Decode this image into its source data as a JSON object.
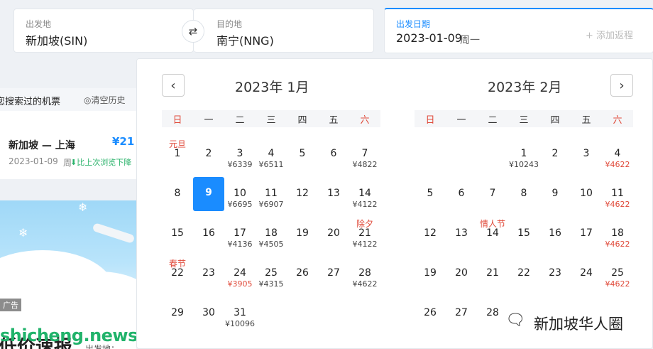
{
  "search": {
    "from_label": "出发地",
    "from_value": "新加坡(SIN)",
    "to_label": "目的地",
    "to_value": "南宁(NNG)",
    "date_label": "出发日期",
    "date_value": "2023-01-09",
    "date_weekday": "周一",
    "return_label": "+ 添加返程",
    "swap_icon": "⇄"
  },
  "history": {
    "title": "您搜索过的机票",
    "clear": "◎清空历史",
    "route": "新加坡 — 上海",
    "price": "¥21",
    "date": "2023-01-09",
    "weekday": "周",
    "compare": "⬇比上次浏览下降"
  },
  "banner": {
    "ad": "广告",
    "bottom_big": "低价速报",
    "bottom_from": "出发地："
  },
  "watermarks": {
    "left": "shicheng.news",
    "right": "新加坡华人圈",
    "right_icon": "🗨"
  },
  "calendar": {
    "prev_icon": "‹",
    "next_icon": "›",
    "weekdays": [
      "日",
      "一",
      "二",
      "三",
      "四",
      "五",
      "六"
    ],
    "months": [
      {
        "title": "2023年 1月",
        "offset": 0,
        "days": [
          {
            "d": "1",
            "f": "元旦",
            "p": ""
          },
          {
            "d": "2",
            "f": "",
            "p": ""
          },
          {
            "d": "3",
            "f": "",
            "p": "¥6339"
          },
          {
            "d": "4",
            "f": "",
            "p": "¥6511"
          },
          {
            "d": "5",
            "f": "",
            "p": ""
          },
          {
            "d": "6",
            "f": "",
            "p": ""
          },
          {
            "d": "7",
            "f": "",
            "p": "¥4822"
          },
          {
            "d": "8",
            "f": "",
            "p": ""
          },
          {
            "d": "9",
            "f": "",
            "p": "",
            "sel": true
          },
          {
            "d": "10",
            "f": "",
            "p": "¥6695"
          },
          {
            "d": "11",
            "f": "",
            "p": "¥6907"
          },
          {
            "d": "12",
            "f": "",
            "p": ""
          },
          {
            "d": "13",
            "f": "",
            "p": ""
          },
          {
            "d": "14",
            "f": "",
            "p": "¥4122"
          },
          {
            "d": "15",
            "f": "",
            "p": ""
          },
          {
            "d": "16",
            "f": "",
            "p": ""
          },
          {
            "d": "17",
            "f": "",
            "p": "¥4136"
          },
          {
            "d": "18",
            "f": "",
            "p": "¥4505"
          },
          {
            "d": "19",
            "f": "",
            "p": ""
          },
          {
            "d": "20",
            "f": "",
            "p": ""
          },
          {
            "d": "21",
            "f": "除夕",
            "p": "¥4122"
          },
          {
            "d": "22",
            "f": "春节",
            "p": ""
          },
          {
            "d": "23",
            "f": "",
            "p": ""
          },
          {
            "d": "24",
            "f": "",
            "p": "¥3905",
            "red": true
          },
          {
            "d": "25",
            "f": "",
            "p": "¥4315"
          },
          {
            "d": "26",
            "f": "",
            "p": ""
          },
          {
            "d": "27",
            "f": "",
            "p": ""
          },
          {
            "d": "28",
            "f": "",
            "p": "¥4622"
          },
          {
            "d": "29",
            "f": "",
            "p": ""
          },
          {
            "d": "30",
            "f": "",
            "p": ""
          },
          {
            "d": "31",
            "f": "",
            "p": "¥10096"
          }
        ]
      },
      {
        "title": "2023年 2月",
        "offset": 3,
        "days": [
          {
            "d": "1",
            "f": "",
            "p": "¥10243"
          },
          {
            "d": "2",
            "f": "",
            "p": ""
          },
          {
            "d": "3",
            "f": "",
            "p": ""
          },
          {
            "d": "4",
            "f": "",
            "p": "¥4622",
            "red": true
          },
          {
            "d": "5",
            "f": "",
            "p": ""
          },
          {
            "d": "6",
            "f": "",
            "p": ""
          },
          {
            "d": "7",
            "f": "",
            "p": ""
          },
          {
            "d": "8",
            "f": "",
            "p": ""
          },
          {
            "d": "9",
            "f": "",
            "p": ""
          },
          {
            "d": "10",
            "f": "",
            "p": ""
          },
          {
            "d": "11",
            "f": "",
            "p": "¥4622",
            "red": true
          },
          {
            "d": "12",
            "f": "",
            "p": ""
          },
          {
            "d": "13",
            "f": "",
            "p": ""
          },
          {
            "d": "14",
            "f": "情人节",
            "p": ""
          },
          {
            "d": "15",
            "f": "",
            "p": ""
          },
          {
            "d": "16",
            "f": "",
            "p": ""
          },
          {
            "d": "17",
            "f": "",
            "p": ""
          },
          {
            "d": "18",
            "f": "",
            "p": "¥4622",
            "red": true
          },
          {
            "d": "19",
            "f": "",
            "p": ""
          },
          {
            "d": "20",
            "f": "",
            "p": ""
          },
          {
            "d": "21",
            "f": "",
            "p": ""
          },
          {
            "d": "22",
            "f": "",
            "p": ""
          },
          {
            "d": "23",
            "f": "",
            "p": ""
          },
          {
            "d": "24",
            "f": "",
            "p": ""
          },
          {
            "d": "25",
            "f": "",
            "p": "¥4622",
            "red": true
          },
          {
            "d": "26",
            "f": "",
            "p": ""
          },
          {
            "d": "27",
            "f": "",
            "p": ""
          },
          {
            "d": "28",
            "f": "",
            "p": ""
          }
        ]
      }
    ]
  }
}
